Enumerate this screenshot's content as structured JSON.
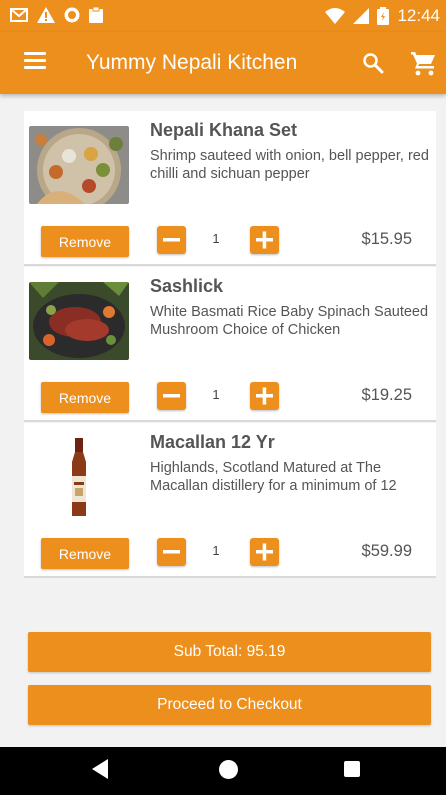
{
  "status_bar": {
    "time": "12:44",
    "icons_left": [
      "gmail-icon",
      "warning-icon",
      "record-icon",
      "clipboard-icon"
    ],
    "icons_right": [
      "wifi-icon",
      "signal-icon",
      "battery-icon"
    ]
  },
  "app_bar": {
    "title": "Yummy Nepali Kitchen",
    "icons": [
      "menu-icon",
      "search-icon",
      "cart-icon"
    ]
  },
  "cart": {
    "remove_label": "Remove",
    "items": [
      {
        "name": "Nepali Khana Set",
        "description": "Shrimp sauteed with onion, bell pepper, red chilli and sichuan pepper",
        "quantity": "1",
        "price": "$15.95"
      },
      {
        "name": "Sashlick",
        "description": "White Basmati Rice Baby Spinach Sauteed Mushroom Choice of Chicken",
        "quantity": "1",
        "price": "$19.25"
      },
      {
        "name": "Macallan 12 Yr",
        "description": "Highlands, Scotland Matured at The Macallan distillery for a minimum of 12",
        "quantity": "1",
        "price": "$59.99"
      }
    ],
    "subtotal": "Sub Total: 95.19",
    "checkout_label": "Proceed to Checkout"
  },
  "colors": {
    "accent": "#ed8f1c",
    "background": "#f2f2f2",
    "text": "#555555"
  }
}
